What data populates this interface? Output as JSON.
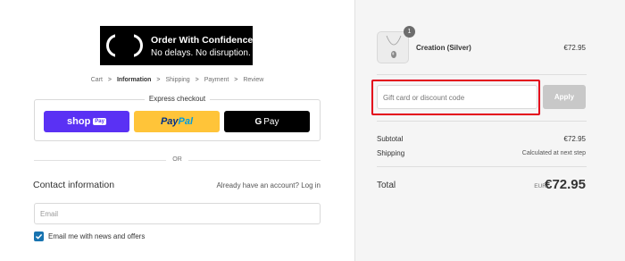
{
  "banner": {
    "title": "Order With Confidence",
    "subtitle": "No delays. No disruption."
  },
  "breadcrumb": {
    "items": [
      "Cart",
      "Information",
      "Shipping",
      "Payment",
      "Review"
    ],
    "separator": ">",
    "active": "Information"
  },
  "express": {
    "label": "Express checkout",
    "shop_pay": {
      "word": "shop",
      "tag": "Pay"
    },
    "paypal": {
      "part1": "Pay",
      "part2": "Pal"
    },
    "gpay": {
      "g": "G",
      "label": "Pay"
    }
  },
  "divider": {
    "text": "OR"
  },
  "contact": {
    "title": "Contact information",
    "account_prompt": "Already have an account?",
    "login_link": "Log in",
    "email_placeholder": "Email",
    "newsletter_label": "Email me with news and offers",
    "newsletter_checked": true
  },
  "summary": {
    "product": {
      "name": "Creation (Silver)",
      "price": "€72.95",
      "quantity": "1"
    },
    "gift_placeholder": "Gift card or discount code",
    "apply_label": "Apply",
    "subtotal_label": "Subtotal",
    "subtotal_value": "€72.95",
    "shipping_label": "Shipping",
    "shipping_value": "Calculated at next step",
    "total_label": "Total",
    "currency": "EUR",
    "total_value": "€72.95"
  },
  "colors": {
    "shop_pay": "#5a31f4",
    "paypal": "#ffc439",
    "gpay": "#000000",
    "checkbox": "#1773b0",
    "highlight": "#e3001b",
    "apply_disabled": "#c8c8c8"
  }
}
